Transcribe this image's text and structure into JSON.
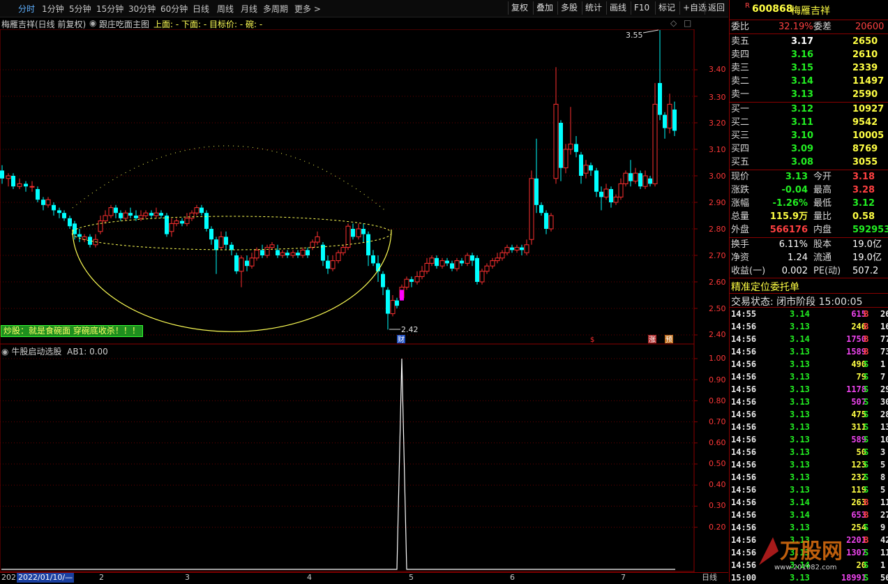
{
  "toolbar": {
    "periods": [
      "分时",
      "1分钟",
      "5分钟",
      "15分钟",
      "30分钟",
      "60分钟",
      "日线",
      "周线",
      "月线",
      "多周期",
      "更多 >"
    ],
    "buttons": [
      "复权",
      "叠加",
      "多股",
      "统计",
      "画线",
      "F10",
      "标记",
      "+自选",
      "返回"
    ]
  },
  "info_line": {
    "stock": "梅雁吉祥(日线 前复权)",
    "indicator": "跟庄吃面主图",
    "fields": "上面: -  下面: -  目标价: -  碗: -"
  },
  "main_chart": {
    "price_labels": [
      "3.40",
      "3.30",
      "3.20",
      "3.10",
      "3.00",
      "2.90",
      "2.80",
      "2.70",
      "2.60",
      "2.50",
      "2.40"
    ],
    "high_marker": "3.55",
    "low_marker": "2.42",
    "banner": "炒股：就是食碗面 穿碗底收杀！！！",
    "markers": {
      "cai": "财",
      "s": "$",
      "zhang": "涨",
      "yu": "预"
    }
  },
  "sub_chart": {
    "title": "牛股启动选股",
    "ab1": "AB1: 0.00",
    "labels": [
      "1.00",
      "0.90",
      "0.80",
      "0.70",
      "0.60",
      "0.50",
      "0.40",
      "0.30",
      "0.20"
    ]
  },
  "x_axis": {
    "date": "2022/01/10/—",
    "year_prefix": "202",
    "months": [
      "2",
      "3",
      "4",
      "5",
      "6",
      "7"
    ],
    "tab": "日线"
  },
  "quote": {
    "code": "600868",
    "name": "梅雁吉祥",
    "weibi_label": "委比",
    "weibi": "32.19%",
    "weicha_label": "委差",
    "weicha": "20600",
    "asks": [
      {
        "label": "卖五",
        "price": "3.17",
        "vol": "2650"
      },
      {
        "label": "卖四",
        "price": "3.16",
        "vol": "2610"
      },
      {
        "label": "卖三",
        "price": "3.15",
        "vol": "2339"
      },
      {
        "label": "卖二",
        "price": "3.14",
        "vol": "11497"
      },
      {
        "label": "卖一",
        "price": "3.13",
        "vol": "2590"
      }
    ],
    "bids": [
      {
        "label": "买一",
        "price": "3.12",
        "vol": "10927"
      },
      {
        "label": "买二",
        "price": "3.11",
        "vol": "9542"
      },
      {
        "label": "买三",
        "price": "3.10",
        "vol": "10005"
      },
      {
        "label": "买四",
        "price": "3.09",
        "vol": "8769"
      },
      {
        "label": "买五",
        "price": "3.08",
        "vol": "3055"
      }
    ],
    "stats": [
      {
        "l1": "现价",
        "v1": "3.13",
        "l2": "今开",
        "v2": "3.18"
      },
      {
        "l1": "涨跌",
        "v1": "-0.04",
        "l2": "最高",
        "v2": "3.28"
      },
      {
        "l1": "涨幅",
        "v1": "-1.26%",
        "l2": "最低",
        "v2": "3.12"
      },
      {
        "l1": "总量",
        "v1": "115.9万",
        "l2": "量比",
        "v2": "0.58"
      },
      {
        "l1": "外盘",
        "v1": "566176",
        "l2": "内盘",
        "v2": "592953"
      }
    ],
    "stats2": [
      {
        "l1": "换手",
        "v1": "6.11%",
        "l2": "股本",
        "v2": "19.0亿"
      },
      {
        "l1": "净资",
        "v1": "1.24",
        "l2": "流通",
        "v2": "19.0亿"
      },
      {
        "l1": "收益(一)",
        "v1": "0.002",
        "l2": "PE(动)",
        "v2": "507.2"
      }
    ],
    "section_title": "精准定位委托单",
    "trade_status": "交易状态: 闭市阶段 15:00:05"
  },
  "ticks": [
    {
      "t": "14:55",
      "p": "3.14",
      "v": "615",
      "s": "B",
      "n": "26"
    },
    {
      "t": "14:56",
      "p": "3.13",
      "v": "246",
      "s": "B",
      "n": "16"
    },
    {
      "t": "14:56",
      "p": "3.14",
      "v": "1750",
      "s": "B",
      "n": "77"
    },
    {
      "t": "14:56",
      "p": "3.13",
      "v": "1589",
      "s": "B",
      "n": "73"
    },
    {
      "t": "14:56",
      "p": "3.13",
      "v": "490",
      "s": "S",
      "n": "1"
    },
    {
      "t": "14:56",
      "p": "3.13",
      "v": "79",
      "s": "S",
      "n": "7"
    },
    {
      "t": "14:56",
      "p": "3.13",
      "v": "1178",
      "s": "S",
      "n": "29"
    },
    {
      "t": "14:56",
      "p": "3.13",
      "v": "507",
      "s": "S",
      "n": "30"
    },
    {
      "t": "14:56",
      "p": "3.13",
      "v": "475",
      "s": "S",
      "n": "28"
    },
    {
      "t": "14:56",
      "p": "3.13",
      "v": "311",
      "s": "S",
      "n": "13"
    },
    {
      "t": "14:56",
      "p": "3.13",
      "v": "589",
      "s": "S",
      "n": "10"
    },
    {
      "t": "14:56",
      "p": "3.13",
      "v": "50",
      "s": "S",
      "n": "3"
    },
    {
      "t": "14:56",
      "p": "3.13",
      "v": "123",
      "s": "S",
      "n": "5"
    },
    {
      "t": "14:56",
      "p": "3.13",
      "v": "232",
      "s": "S",
      "n": "8"
    },
    {
      "t": "14:56",
      "p": "3.13",
      "v": "119",
      "s": "S",
      "n": "5"
    },
    {
      "t": "14:56",
      "p": "3.14",
      "v": "263",
      "s": "B",
      "n": "11"
    },
    {
      "t": "14:56",
      "p": "3.14",
      "v": "653",
      "s": "B",
      "n": "27"
    },
    {
      "t": "14:56",
      "p": "3.13",
      "v": "254",
      "s": "S",
      "n": "9"
    },
    {
      "t": "14:56",
      "p": "3.13",
      "v": "2201",
      "s": "B",
      "n": "42"
    },
    {
      "t": "14:56",
      "p": "3.13",
      "v": "1307",
      "s": "S",
      "n": "11"
    },
    {
      "t": "14:56",
      "p": "3.14",
      "v": "20",
      "s": "S",
      "n": "1"
    },
    {
      "t": "15:00",
      "p": "3.13",
      "v": "18991",
      "s": "S",
      "n": "56"
    }
  ],
  "watermark": {
    "text": "万股网",
    "url": "www.201082.com"
  },
  "colors": {
    "up": "#ff3030",
    "down": "#00ffff",
    "bowl": "#ffff55",
    "frame": "#8b0000"
  }
}
